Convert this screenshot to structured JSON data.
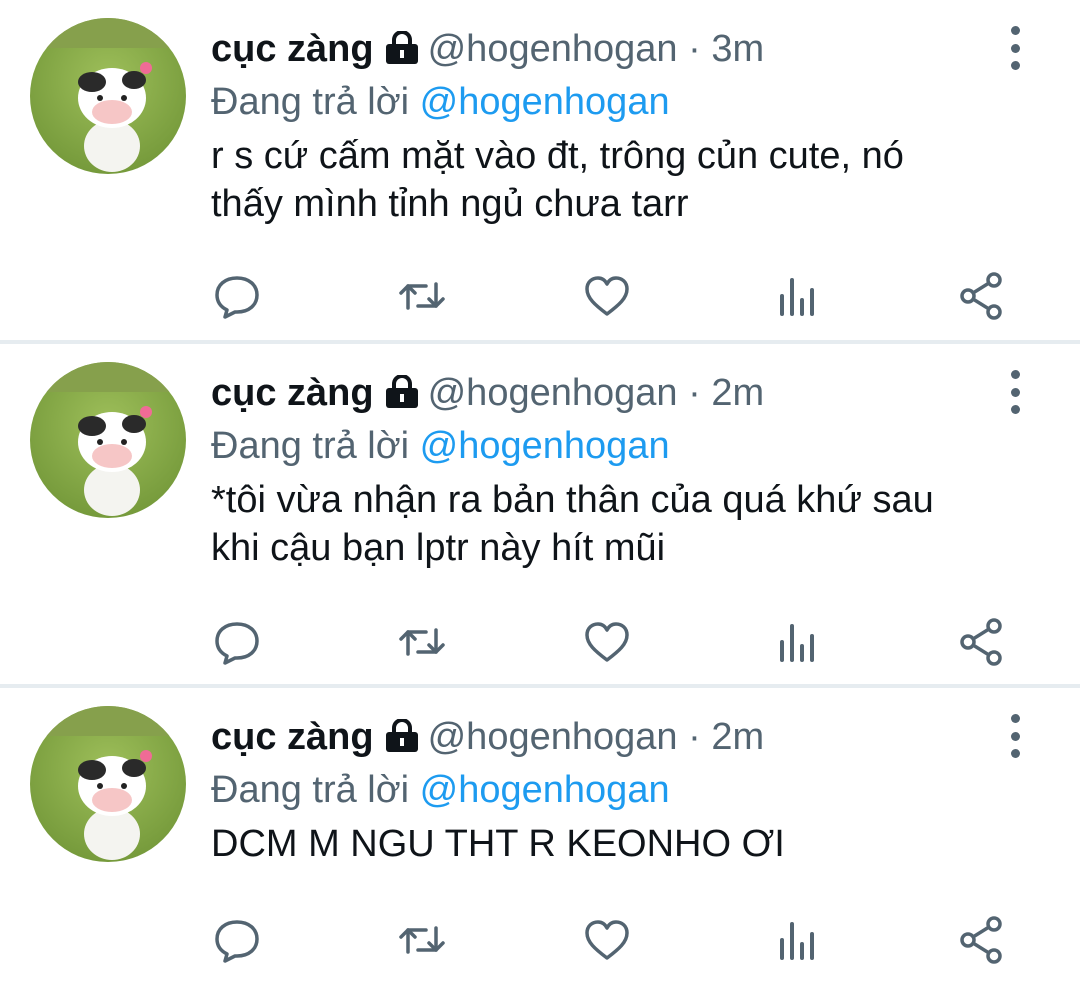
{
  "colors": {
    "text": "#0f1419",
    "secondary": "#536471",
    "mention": "#1d9bf0",
    "divider": "#e6ecf0"
  },
  "icons": {
    "protected": "lock-icon",
    "more": "more-vertical-icon",
    "reply": "reply-icon",
    "retweet": "retweet-icon",
    "like": "heart-icon",
    "views": "views-chart-icon",
    "share": "share-icon"
  },
  "tweets": [
    {
      "name": "cục zàng",
      "handle": "@hogenhogan",
      "separator": "·",
      "time": "3m",
      "reply_prefix": "Đang trả lời",
      "reply_to": "@hogenhogan",
      "text_lines": [
        "r s cứ cấm mặt vào đt, trông củn cute, nó",
        "thấy mình tỉnh ngủ chưa tarr"
      ]
    },
    {
      "name": "cục zàng",
      "handle": "@hogenhogan",
      "separator": "·",
      "time": "2m",
      "reply_prefix": "Đang trả lời",
      "reply_to": "@hogenhogan",
      "text_lines": [
        "*tôi vừa nhận ra bản thân của quá khứ sau",
        "khi cậu bạn lptr này hít mũi"
      ]
    },
    {
      "name": "cục zàng",
      "handle": "@hogenhogan",
      "separator": "·",
      "time": "2m",
      "reply_prefix": "Đang trả lời",
      "reply_to": "@hogenhogan",
      "text_lines": [
        "DCM M NGU THT R KEONHO ƠI"
      ]
    }
  ]
}
